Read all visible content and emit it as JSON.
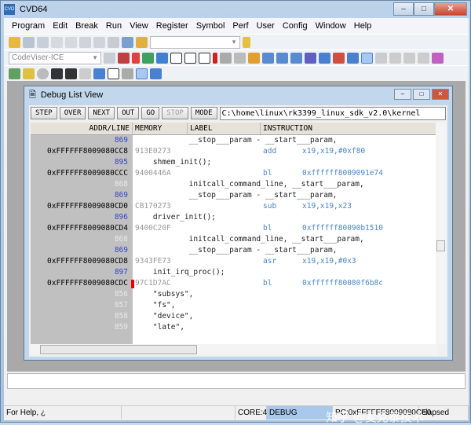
{
  "app": {
    "title": "CVD64",
    "icon": "CVD"
  },
  "menu": [
    "Program",
    "Edit",
    "Break",
    "Run",
    "View",
    "Register",
    "Symbol",
    "Perf",
    "User",
    "Config",
    "Window",
    "Help"
  ],
  "toolbar": {
    "target_combo": "CodeViser-ICE"
  },
  "child": {
    "title": "Debug List View",
    "buttons": [
      {
        "label": "STEP",
        "enabled": true
      },
      {
        "label": "OVER",
        "enabled": true
      },
      {
        "label": "NEXT",
        "enabled": true
      },
      {
        "label": "OUT",
        "enabled": true
      },
      {
        "label": "GO",
        "enabled": true
      },
      {
        "label": "STOP",
        "enabled": false
      },
      {
        "label": "MODE",
        "enabled": true
      }
    ],
    "path": "C:\\home\\linux\\rk3399_linux_sdk_v2.0\\kernel",
    "headers": [
      "ADDR/LINE",
      "MEMORY",
      "LABEL",
      "INSTRUCTION"
    ],
    "rows": [
      {
        "line": "869",
        "hl": true,
        "src": "            __stop___param - __start___param,"
      },
      {
        "addr": "0xFFFFFF8009080CC8",
        "mem": "913E0273",
        "mn": "add",
        "op": "x19,x19,#0xf80"
      },
      {
        "line": "895",
        "hl": true,
        "src": "    shmem_init();"
      },
      {
        "addr": "0xFFFFFF8009080CCC",
        "mem": "9400446A",
        "mn": "bl",
        "op": "0xffffff8009091e74"
      },
      {
        "line": "868",
        "hl": false,
        "src": "            initcall_command_line, __start___param,"
      },
      {
        "line": "869",
        "hl": true,
        "src": "            __stop___param - __start___param,"
      },
      {
        "addr": "0xFFFFFF8009080CD0",
        "mem": "CB170273",
        "mn": "sub",
        "op": "x19,x19,x23"
      },
      {
        "line": "896",
        "hl": true,
        "src": "    driver_init();"
      },
      {
        "addr": "0xFFFFFF8009080CD4",
        "mem": "9400C20F",
        "mn": "bl",
        "op": "0xffffff80090b1510"
      },
      {
        "line": "868",
        "hl": false,
        "src": "            initcall_command_line, __start___param,"
      },
      {
        "line": "869",
        "hl": true,
        "src": "            __stop___param - __start___param,"
      },
      {
        "addr": "0xFFFFFF8009080CD8",
        "mem": "9343FE73",
        "mn": "asr",
        "op": "x19,x19,#0x3"
      },
      {
        "line": "897",
        "hl": true,
        "src": "    init_irq_proc();"
      },
      {
        "addr": "0xFFFFFF8009080CDC",
        "mem": "97C1D7AC",
        "mn": "bl",
        "op": "0xffffff80080f6b8c",
        "bp": true
      },
      {
        "line": "856",
        "hl": false,
        "src": "    \"subsys\","
      },
      {
        "line": "857",
        "hl": false,
        "src": "    \"fs\","
      },
      {
        "line": "858",
        "hl": false,
        "src": "    \"device\","
      },
      {
        "line": "859",
        "hl": false,
        "src": "    \"late\","
      }
    ]
  },
  "status": {
    "help": "For Help, ¿",
    "core": "CORE:4",
    "mode": "DEBUG",
    "pc": "PC:0xFFFFFF8009080CE0",
    "elapsed": "elapsed"
  },
  "watermark": "知乎 @麦克泰技术"
}
